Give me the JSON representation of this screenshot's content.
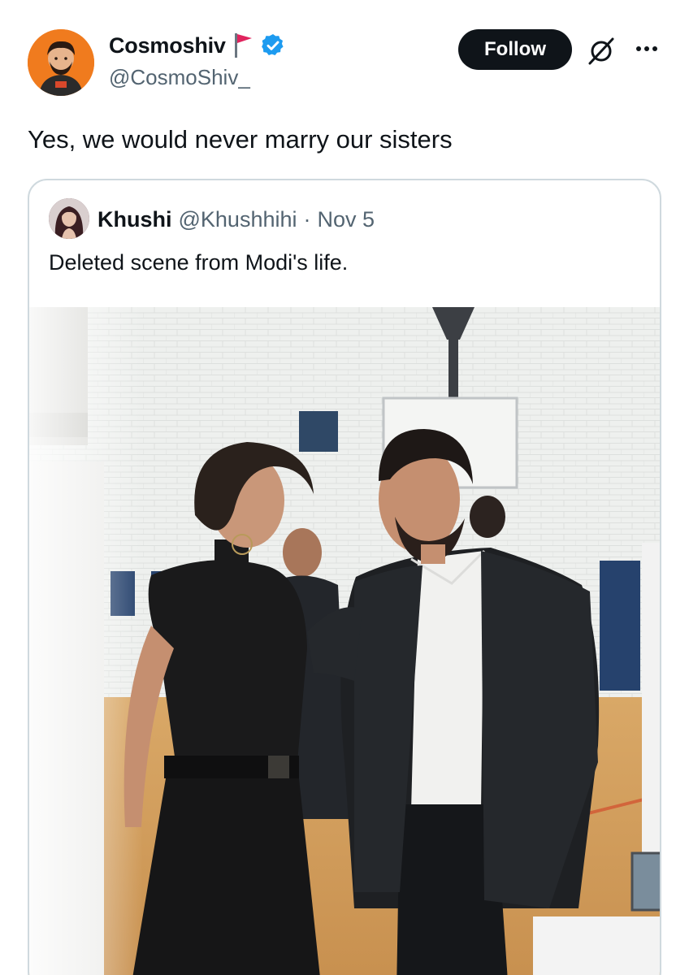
{
  "tweet": {
    "author": {
      "display_name": "Cosmoshiv",
      "handle": "@CosmoShiv_",
      "badges": [
        "red-flag-icon",
        "verified-check-icon"
      ]
    },
    "follow_label": "Follow",
    "text": "Yes, we would never marry our sisters"
  },
  "quoted": {
    "author_name": "Khushi",
    "author_handle": "@Khushhihi",
    "separator": "·",
    "date": "Nov 5",
    "text": "Deleted scene from Modi's life."
  },
  "colors": {
    "follow_bg": "#0f1419",
    "verified": "#1d9bf0",
    "flag": "#e0245e",
    "secondary_text": "#536471",
    "card_border": "#cfd9de",
    "avatar_bg": "#f07b1e"
  }
}
